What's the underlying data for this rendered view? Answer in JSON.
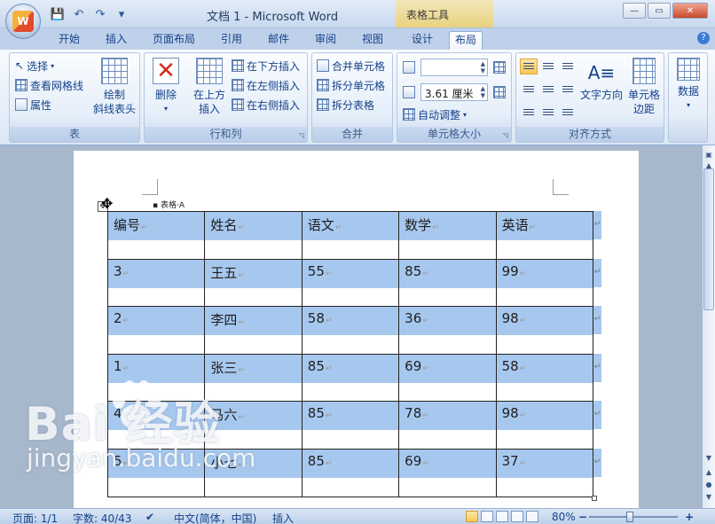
{
  "window": {
    "title": "文档 1 - Microsoft Word",
    "context_tab_title": "表格工具",
    "office_button_glyph": "W",
    "qat_icons": [
      "save-icon",
      "undo-icon",
      "redo-icon",
      "customize-qat-icon"
    ],
    "minimize": "—",
    "maximize": "▭",
    "close": "✕"
  },
  "tabs": [
    "开始",
    "插入",
    "页面布局",
    "引用",
    "邮件",
    "审阅",
    "视图",
    "设计",
    "布局"
  ],
  "active_tab": "布局",
  "ribbon": {
    "table_group": {
      "label": "表",
      "select": "选择",
      "view_gridlines": "查看网格线",
      "properties": "属性",
      "draw_diagonal_line1": "绘制",
      "draw_diagonal_line2": "斜线表头"
    },
    "rows_cols_group": {
      "label": "行和列",
      "delete": "删除",
      "insert_above_line1": "在上方",
      "insert_above_line2": "插入",
      "insert_below": "在下方插入",
      "insert_left": "在左侧插入",
      "insert_right": "在右侧插入"
    },
    "merge_group": {
      "label": "合并",
      "merge_cells": "合并单元格",
      "split_cells": "拆分单元格",
      "split_table": "拆分表格"
    },
    "cell_size_group": {
      "label": "单元格大小",
      "height_value": "",
      "width_value": "3.61 厘米",
      "autofit": "自动调整"
    },
    "alignment_group": {
      "label": "对齐方式",
      "text_direction": "文字方向",
      "cell_margins_line1": "单元格",
      "cell_margins_line2": "边距"
    },
    "data_group": {
      "label": "数据"
    }
  },
  "document": {
    "caption": "表格·A",
    "table": {
      "header": [
        "编号",
        "姓名",
        "语文",
        "数学",
        "英语"
      ],
      "rows": [
        [
          "3",
          "王五",
          "55",
          "85",
          "99"
        ],
        [
          "2",
          "李四",
          "58",
          "36",
          "98"
        ],
        [
          "1",
          "张三",
          "85",
          "69",
          "58"
        ],
        [
          "4",
          "马六",
          "85",
          "78",
          "98"
        ],
        [
          "5",
          "小七",
          "85",
          "69",
          "37"
        ]
      ]
    }
  },
  "status": {
    "page": "页面: 1/1",
    "words": "字数: 40/43",
    "language": "中文(简体，中国)",
    "mode": "插入",
    "zoom": "80%"
  },
  "watermark": {
    "logo": "Bai 经验",
    "url": "jingyan.baidu.com"
  },
  "colors": {
    "selection": "#a7c8ee",
    "ribbon_text": "#15428b"
  }
}
